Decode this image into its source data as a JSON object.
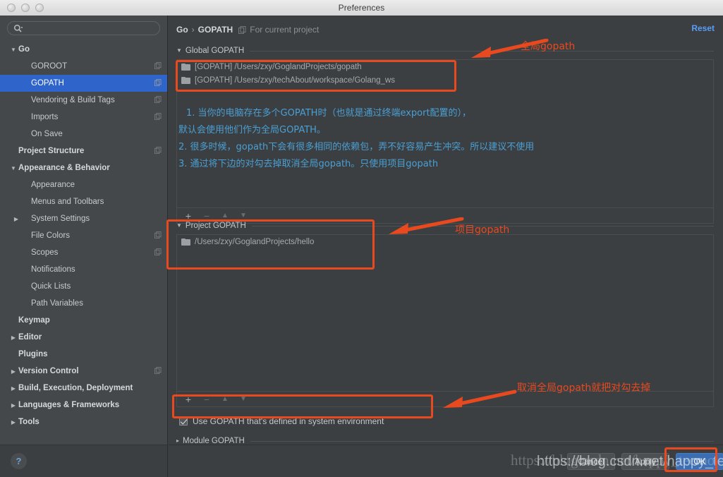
{
  "window": {
    "title": "Preferences",
    "traffic_lights": [
      "close",
      "minimize",
      "zoom"
    ]
  },
  "sidebar": {
    "search": {
      "value": "",
      "placeholder": "",
      "icon": "search-icon"
    },
    "items": [
      {
        "label": "Go",
        "level": 0,
        "bold": true,
        "arrow": "▼",
        "copy": false,
        "selected": false
      },
      {
        "label": "GOROOT",
        "level": 1,
        "bold": false,
        "arrow": "",
        "copy": true,
        "selected": false
      },
      {
        "label": "GOPATH",
        "level": 1,
        "bold": false,
        "arrow": "",
        "copy": true,
        "selected": true
      },
      {
        "label": "Vendoring & Build Tags",
        "level": 1,
        "bold": false,
        "arrow": "",
        "copy": true,
        "selected": false
      },
      {
        "label": "Imports",
        "level": 1,
        "bold": false,
        "arrow": "",
        "copy": true,
        "selected": false
      },
      {
        "label": "On Save",
        "level": 1,
        "bold": false,
        "arrow": "",
        "copy": false,
        "selected": false
      },
      {
        "label": "Project Structure",
        "level": 0,
        "bold": true,
        "arrow": "",
        "copy": true,
        "selected": false
      },
      {
        "label": "Appearance & Behavior",
        "level": 0,
        "bold": true,
        "arrow": "▼",
        "copy": false,
        "selected": false
      },
      {
        "label": "Appearance",
        "level": 1,
        "bold": false,
        "arrow": "",
        "copy": false,
        "selected": false
      },
      {
        "label": "Menus and Toolbars",
        "level": 1,
        "bold": false,
        "arrow": "",
        "copy": false,
        "selected": false
      },
      {
        "label": "System Settings",
        "level": 1,
        "bold": false,
        "arrow": "▶",
        "copy": false,
        "selected": false
      },
      {
        "label": "File Colors",
        "level": 1,
        "bold": false,
        "arrow": "",
        "copy": true,
        "selected": false
      },
      {
        "label": "Scopes",
        "level": 1,
        "bold": false,
        "arrow": "",
        "copy": true,
        "selected": false
      },
      {
        "label": "Notifications",
        "level": 1,
        "bold": false,
        "arrow": "",
        "copy": false,
        "selected": false
      },
      {
        "label": "Quick Lists",
        "level": 1,
        "bold": false,
        "arrow": "",
        "copy": false,
        "selected": false
      },
      {
        "label": "Path Variables",
        "level": 1,
        "bold": false,
        "arrow": "",
        "copy": false,
        "selected": false
      },
      {
        "label": "Keymap",
        "level": 0,
        "bold": true,
        "arrow": "",
        "copy": false,
        "selected": false
      },
      {
        "label": "Editor",
        "level": 0,
        "bold": true,
        "arrow": "▶",
        "copy": false,
        "selected": false
      },
      {
        "label": "Plugins",
        "level": 0,
        "bold": true,
        "arrow": "",
        "copy": false,
        "selected": false
      },
      {
        "label": "Version Control",
        "level": 0,
        "bold": true,
        "arrow": "▶",
        "copy": true,
        "selected": false
      },
      {
        "label": "Build, Execution, Deployment",
        "level": 0,
        "bold": true,
        "arrow": "▶",
        "copy": false,
        "selected": false
      },
      {
        "label": "Languages & Frameworks",
        "level": 0,
        "bold": true,
        "arrow": "▶",
        "copy": false,
        "selected": false
      },
      {
        "label": "Tools",
        "level": 0,
        "bold": true,
        "arrow": "▶",
        "copy": false,
        "selected": false
      }
    ],
    "help_label": "?"
  },
  "breadcrumb": {
    "root": "Go",
    "separator": "›",
    "current": "GOPATH",
    "scope_note": "For current project",
    "scope_icon": "copy-icon"
  },
  "reset": {
    "label": "Reset"
  },
  "global_gopath": {
    "title": "Global GOPATH",
    "collapse_arrow": "▼",
    "entries": [
      {
        "label": "[GOPATH] /Users/zxy/GoglandProjects/gopath",
        "icon": "folder-icon"
      },
      {
        "label": "[GOPATH] /Users/zxy/techAbout/workspace/Golang_ws",
        "icon": "folder-icon"
      }
    ],
    "toolbar": [
      {
        "name": "add-button",
        "glyph": "+",
        "enabled": true
      },
      {
        "name": "remove-button",
        "glyph": "−",
        "enabled": false
      },
      {
        "name": "move-up-button",
        "glyph": "▲",
        "enabled": false
      },
      {
        "name": "move-down-button",
        "glyph": "▼",
        "enabled": false
      }
    ]
  },
  "project_gopath": {
    "title": "Project GOPATH",
    "collapse_arrow": "▼",
    "entries": [
      {
        "label": "/Users/zxy/GoglandProjects/hello",
        "icon": "folder-icon"
      }
    ],
    "toolbar": [
      {
        "name": "add-button",
        "glyph": "+",
        "enabled": true
      },
      {
        "name": "remove-button",
        "glyph": "−",
        "enabled": false
      },
      {
        "name": "move-up-button",
        "glyph": "▲",
        "enabled": false
      },
      {
        "name": "move-down-button",
        "glyph": "▼",
        "enabled": false
      }
    ]
  },
  "system_env_checkbox": {
    "label": "Use GOPATH that's defined in system environment",
    "checked": true
  },
  "module_gopath": {
    "title": "Module GOPATH",
    "collapse_arrow": "▸"
  },
  "info_note": {
    "line1": "1. 当你的电脑存在多个GOPATH时（也就是通过终端export配置的），",
    "line2": "默认会使用他们作为全局GOPATH。",
    "line3": "2. 很多时候，gopath下会有很多相同的依赖包，弄不好容易产生冲突。所以建议不使用",
    "line4": "3. 通过将下边的对勾去掉取消全局gopath。只使用项目gopath",
    "color": "#4a9fd4"
  },
  "annotations": {
    "color": "#e8491f",
    "global_label": "全局gopath",
    "project_label": "项目gopath",
    "checkbox_label": "取消全局gopath就把对勾去掉"
  },
  "buttons": {
    "cancel": "Cancel",
    "apply": "Apply",
    "ok": "OK"
  },
  "watermark": {
    "text1": "https://blog.csdn.net/happy_teemo",
    "text2": "https://blog.csdn.net/happy_teemo"
  }
}
